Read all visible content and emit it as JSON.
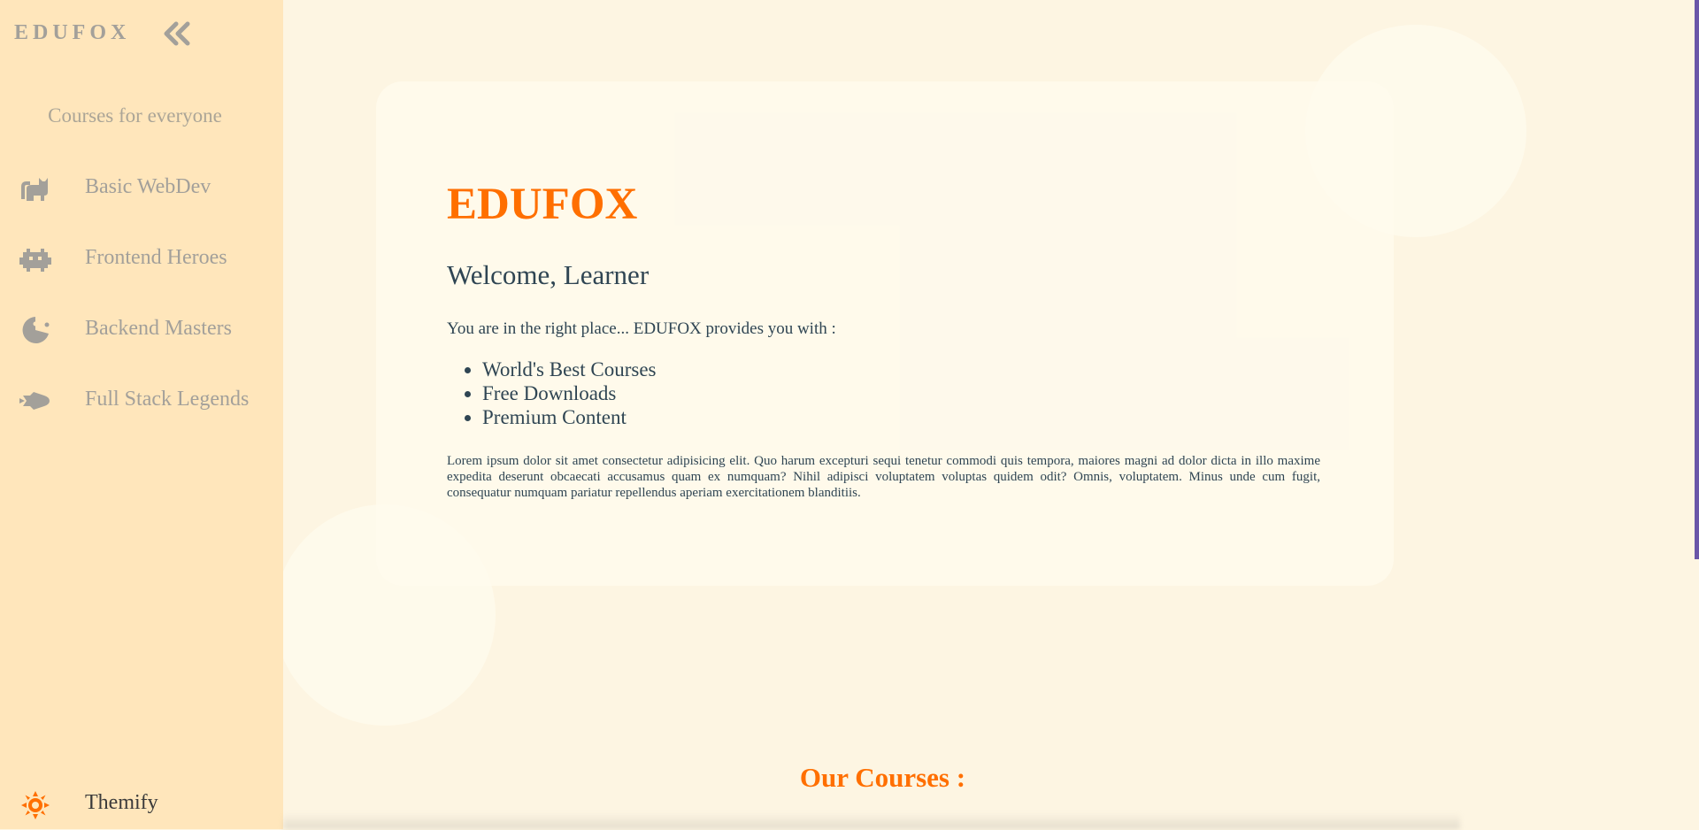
{
  "sidebar": {
    "brand": "EDUFOX",
    "tagline": "Courses for everyone",
    "items": [
      {
        "label": "Basic WebDev",
        "icon": "cat-icon"
      },
      {
        "label": "Frontend Heroes",
        "icon": "space-invader-icon"
      },
      {
        "label": "Backend Masters",
        "icon": "pacman-icon"
      },
      {
        "label": "Full Stack Legends",
        "icon": "rocket-icon"
      }
    ],
    "themify_label": "Themify"
  },
  "hero": {
    "title": "EDUFOX",
    "welcome": "Welcome, Learner",
    "intro": "You are in the right place... EDUFOX provides you with :",
    "features": [
      "World's Best Courses",
      "Free Downloads",
      "Premium Content"
    ],
    "lorem": "Lorem ipsum dolor sit amet consectetur adipisicing elit. Quo harum excepturi sequi tenetur commodi quis tempora, maiores magni ad dolor dicta in illo maxime expedita deserunt obcaecati accusamus quam ex numquam? Nihil adipisci voluptatem voluptas quidem odit? Omnis, voluptatem. Minus unde cum fugit, consequatur numquam pariatur repellendus aperiam exercitationem blanditiis."
  },
  "courses": {
    "title": "Our Courses :"
  },
  "colors": {
    "accent": "#ff6f00",
    "sidebar_bg": "#ffe6bb",
    "main_bg": "#fdf5e2",
    "text_dark": "#2f4553",
    "muted": "#a3a09a",
    "scrollbar": "#6a56a8"
  }
}
